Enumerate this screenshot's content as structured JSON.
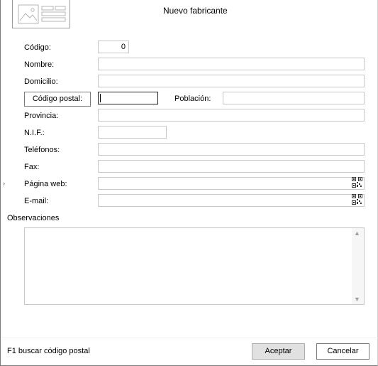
{
  "dialog": {
    "title": "Nuevo fabricante"
  },
  "form": {
    "codigo_label": "Código:",
    "codigo_value": "0",
    "nombre_label": "Nombre:",
    "nombre_value": "",
    "domicilio_label": "Domicilio:",
    "domicilio_value": "",
    "codigo_postal_button": "Código postal:",
    "codigo_postal_value": "",
    "poblacion_label": "Población:",
    "poblacion_value": "",
    "provincia_label": "Provincia:",
    "provincia_value": "",
    "nif_label": "N.I.F.:",
    "nif_value": "",
    "telefonos_label": "Teléfonos:",
    "telefonos_value": "",
    "fax_label": "Fax:",
    "fax_value": "",
    "pagina_web_label": "Página web:",
    "pagina_web_value": "",
    "email_label": "E-mail:",
    "email_value": "",
    "observaciones_label": "Observaciones",
    "observaciones_value": ""
  },
  "footer": {
    "hint": "F1 buscar código postal",
    "accept_label": "Aceptar",
    "cancel_label": "Cancelar"
  },
  "icons": {
    "header": "card-image-icon",
    "qr": "qr-code-icon",
    "row_marker": "chevron-right-icon",
    "scroll_up": "scroll-up-icon",
    "scroll_down": "scroll-down-icon"
  }
}
